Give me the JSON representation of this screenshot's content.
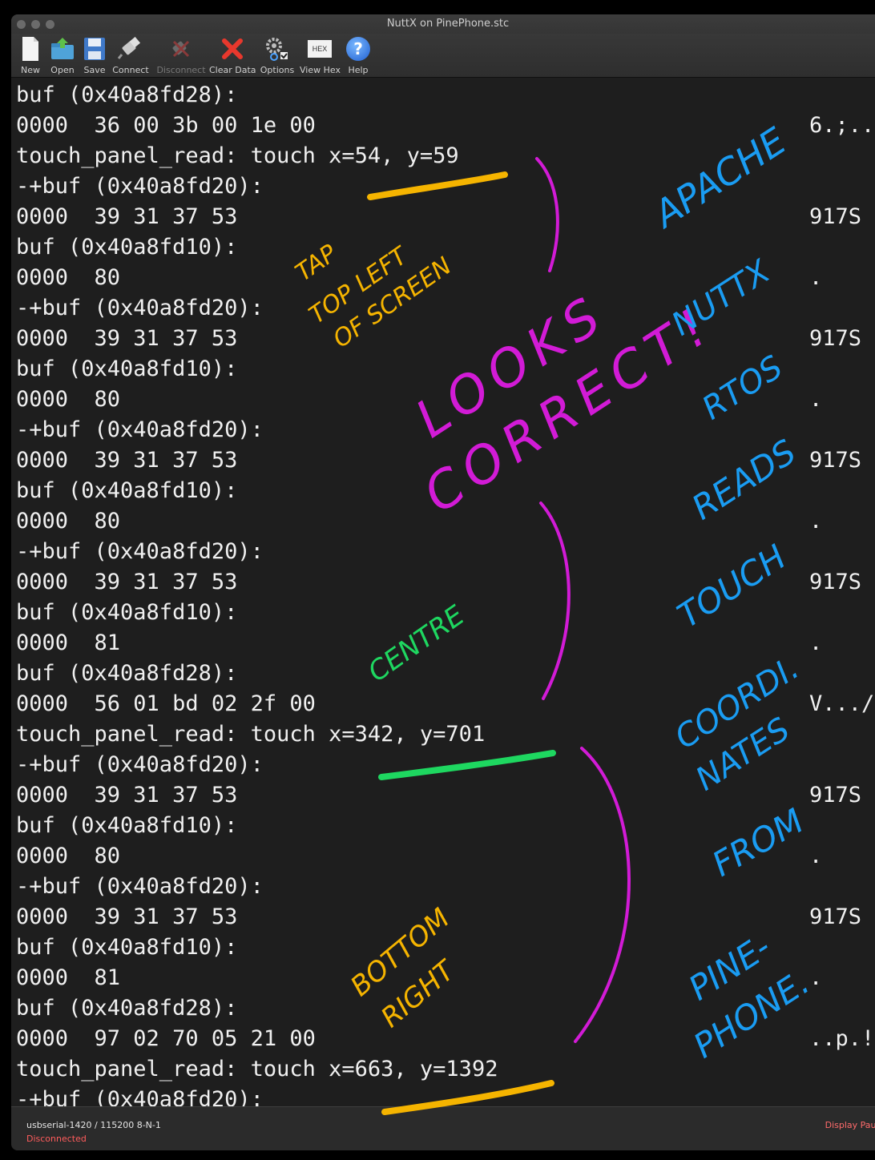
{
  "window": {
    "title": "NuttX on PinePhone.stc"
  },
  "toolbar": {
    "buttons": [
      {
        "label": "New",
        "icon": "new-document-icon"
      },
      {
        "label": "Open",
        "icon": "open-folder-icon"
      },
      {
        "label": "Save",
        "icon": "save-disk-icon"
      },
      {
        "label": "Connect",
        "icon": "usb-plug-icon"
      },
      {
        "label": "Disconnect",
        "icon": "usb-unplug-icon",
        "disabled": true
      },
      {
        "label": "Clear Data",
        "icon": "red-x-icon"
      },
      {
        "label": "Options",
        "icon": "gears-icon"
      },
      {
        "label": "View Hex",
        "icon": "hex-icon"
      },
      {
        "label": "Help",
        "icon": "help-icon"
      }
    ],
    "hex_glyph": "HEX",
    "help_glyph": "?"
  },
  "console": {
    "lines": [
      "buf (0x40a8fd28):",
      "0000  36 00 3b 00 1e 00",
      "touch_panel_read: touch x=54, y=59",
      "-+buf (0x40a8fd20):",
      "0000  39 31 37 53",
      "buf (0x40a8fd10):",
      "0000  80",
      "-+buf (0x40a8fd20):",
      "0000  39 31 37 53",
      "buf (0x40a8fd10):",
      "0000  80",
      "-+buf (0x40a8fd20):",
      "0000  39 31 37 53",
      "buf (0x40a8fd10):",
      "0000  80",
      "-+buf (0x40a8fd20):",
      "0000  39 31 37 53",
      "buf (0x40a8fd10):",
      "0000  81",
      "buf (0x40a8fd28):",
      "0000  56 01 bd 02 2f 00",
      "touch_panel_read: touch x=342, y=701",
      "-+buf (0x40a8fd20):",
      "0000  39 31 37 53",
      "buf (0x40a8fd10):",
      "0000  80",
      "-+buf (0x40a8fd20):",
      "0000  39 31 37 53",
      "buf (0x40a8fd10):",
      "0000  81",
      "buf (0x40a8fd28):",
      "0000  97 02 70 05 21 00",
      "touch_panel_read: touch x=663, y=1392",
      "-+buf (0x40a8fd20):"
    ],
    "ascii": [
      {
        "row": 1,
        "text": "6.;.."
      },
      {
        "row": 4,
        "text": "917S"
      },
      {
        "row": 6,
        "text": "."
      },
      {
        "row": 8,
        "text": "917S"
      },
      {
        "row": 10,
        "text": "."
      },
      {
        "row": 12,
        "text": "917S"
      },
      {
        "row": 14,
        "text": "."
      },
      {
        "row": 16,
        "text": "917S"
      },
      {
        "row": 18,
        "text": "."
      },
      {
        "row": 20,
        "text": "V.../"
      },
      {
        "row": 23,
        "text": "917S"
      },
      {
        "row": 25,
        "text": "."
      },
      {
        "row": 27,
        "text": "917S"
      },
      {
        "row": 29,
        "text": "."
      },
      {
        "row": 31,
        "text": "..p.!"
      }
    ]
  },
  "status": {
    "port": "usbserial-1420 / 115200 8-N-1",
    "connection": "Disconnected",
    "display": "Display Pause"
  },
  "annotations": {
    "tap": "TAP",
    "top_left": "TOP LEFT",
    "of_screen": "OF SCREEN",
    "looks": "LOOKS",
    "correct": "CORRECT!",
    "centre": "CENTRE",
    "bottom": "BOTTOM",
    "right": "RIGHT",
    "apache": "APACHE",
    "nuttx": "NUTTX",
    "rtos": "RTOS",
    "reads": "READS",
    "touch": "TOUCH",
    "coordi": "COORDI.",
    "nates": "NATES",
    "from": "FROM",
    "pine": "PINE-",
    "phone": "PHONE."
  },
  "colors": {
    "yellow": "#f5b400",
    "magenta": "#d21bd6",
    "green": "#1ed760",
    "blue": "#1a9cf2",
    "background": "#1e1e1e"
  }
}
